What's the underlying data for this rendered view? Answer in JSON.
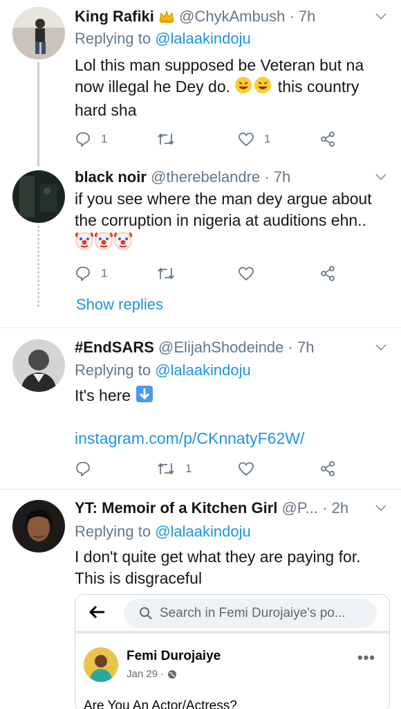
{
  "tweets": [
    {
      "name": "King Rafiki",
      "name_emoji": "crown-icon",
      "handle": "@ChykAmbush",
      "time": "· 7h",
      "replying_prefix": "Replying to ",
      "replying_to": "@lalaakindoju",
      "text": "Lol this man supposed be Veteran but na now illegal he Dey do.",
      "text_tail": " this country hard sha",
      "reply_count": "1",
      "retweet_count": "",
      "like_count": "1"
    },
    {
      "name": "black noir",
      "handle": "@therebelandre",
      "time": "· 7h",
      "text": "if you see where the man dey argue about the corruption in nigeria at auditions ehn..",
      "reply_count": "1",
      "retweet_count": "",
      "like_count": ""
    },
    {
      "name": "#EndSARS",
      "handle": "@ElijahShodeinde",
      "time": "· 7h",
      "replying_prefix": "Replying to ",
      "replying_to": "@lalaakindoju",
      "text": "It's here",
      "link": "instagram.com/p/CKnnatyF62W/",
      "reply_count": "",
      "retweet_count": "1",
      "like_count": ""
    },
    {
      "name": "YT: Memoir of a Kitchen Girl",
      "handle": "@P...",
      "time": "· 2h",
      "replying_prefix": "Replying to ",
      "replying_to": "@lalaakindoju",
      "text": "I don't quite get what they are paying for. This is disgraceful"
    }
  ],
  "show_replies": "Show replies",
  "embed": {
    "search_placeholder": "Search in Femi Durojaiye's po...",
    "author": "Femi Durojaiye",
    "date": "Jan 29 ·",
    "post_text": "Are You An Actor/Actress?"
  },
  "colors": {
    "link": "#1b95e0",
    "muted": "#657786",
    "text": "#14171a"
  }
}
